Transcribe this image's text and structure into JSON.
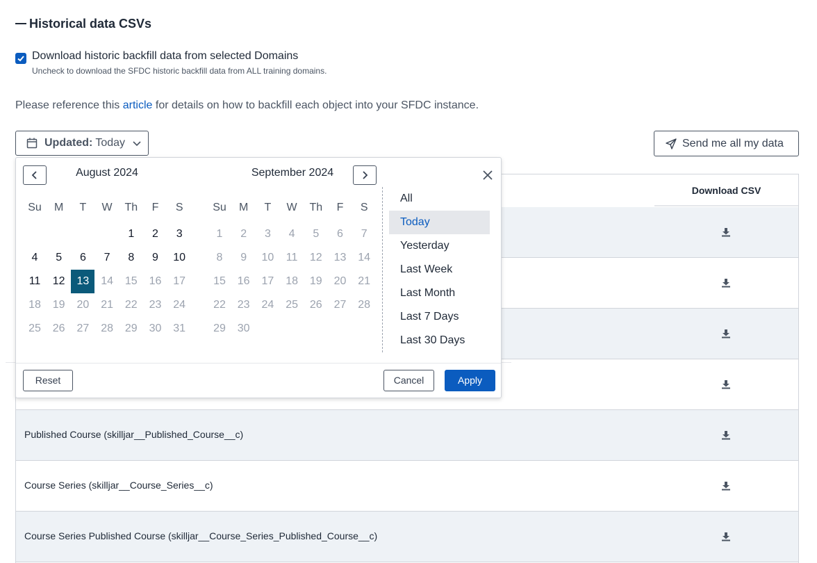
{
  "section": {
    "title": "Historical data CSVs"
  },
  "backfill": {
    "checked": true,
    "label": "Download historic backfill data from selected Domains",
    "help": "Uncheck to download the SFDC historic backfill data from ALL training domains."
  },
  "reference": {
    "before": "Please reference this ",
    "link": "article",
    "after": " for details on how to backfill each object into your SFDC instance."
  },
  "filter": {
    "label": "Updated:",
    "value": "Today"
  },
  "send_button": {
    "label": "Send me all my data"
  },
  "table": {
    "header_download": "Download CSV",
    "rows": [
      {
        "name": ""
      },
      {
        "name": ""
      },
      {
        "name": ""
      },
      {
        "name": ""
      },
      {
        "name": "Published Course (skilljar__Published_Course__c)"
      },
      {
        "name": "Course Series (skilljar__Course_Series__c)"
      },
      {
        "name": "Course Series Published Course (skilljar__Course_Series_Published_Course__c)"
      }
    ]
  },
  "datepicker": {
    "weekdays": [
      "Su",
      "M",
      "T",
      "W",
      "Th",
      "F",
      "S"
    ],
    "months": [
      {
        "title": "August 2024",
        "weeks": [
          [
            "",
            "",
            "",
            "1",
            "2",
            "3"
          ],
          [
            "4",
            "5",
            "6",
            "7",
            "8",
            "9",
            "10"
          ],
          [
            "11",
            "12",
            "13",
            "14",
            "15",
            "16",
            "17"
          ],
          [
            "18",
            "19",
            "20",
            "21",
            "22",
            "23",
            "24"
          ],
          [
            "25",
            "26",
            "27",
            "28",
            "29",
            "30",
            "31"
          ]
        ]
      },
      {
        "title": "September 2024",
        "weeks": [
          [
            "1",
            "2",
            "3",
            "4",
            "5",
            "6",
            "7"
          ],
          [
            "8",
            "9",
            "10",
            "11",
            "12",
            "13",
            "14"
          ],
          [
            "15",
            "16",
            "17",
            "18",
            "19",
            "20",
            "21"
          ],
          [
            "22",
            "23",
            "24",
            "25",
            "26",
            "27",
            "28"
          ],
          [
            "29",
            "30"
          ]
        ]
      }
    ],
    "selected_day": "13",
    "presets": [
      "All",
      "Today",
      "Yesterday",
      "Last Week",
      "Last Month",
      "Last 7 Days",
      "Last 30 Days"
    ],
    "selected_preset": "Today",
    "reset_label": "Reset",
    "cancel_label": "Cancel",
    "apply_label": "Apply"
  },
  "colors": {
    "accent": "#0b5cbf",
    "selected_day": "#0b5a7a",
    "row_shade": "#eef2f6"
  }
}
